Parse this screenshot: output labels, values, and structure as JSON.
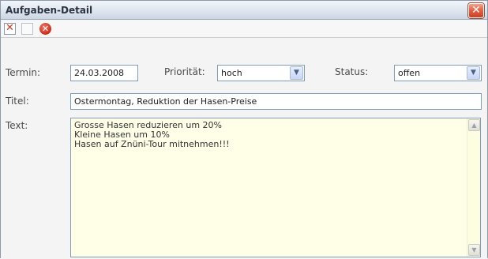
{
  "window": {
    "title": "Aufgaben-Detail",
    "close_symbol": "✕"
  },
  "toolbar": {
    "check_symbol": "✕",
    "delete_symbol": "✕"
  },
  "form": {
    "termin_label": "Termin:",
    "termin_value": "24.03.2008",
    "prioritaet_label": "Priorität:",
    "prioritaet_value": "hoch",
    "status_label": "Status:",
    "status_value": "offen",
    "titel_label": "Titel:",
    "titel_value": "Ostermontag, Reduktion der Hasen-Preise",
    "text_label": "Text:",
    "text_lines": [
      "Grosse Hasen reduzieren um 20%",
      "Kleine Hasen um 10%",
      "Hasen auf Znüni-Tour mitnehmen!!!"
    ]
  },
  "colors": {
    "textarea_background": "#ffffe8",
    "close_button": "#e05f3f",
    "input_border": "#7f9db9"
  },
  "icons": {
    "close": "close-icon",
    "select_arrow": "chevron-down-icon",
    "scroll_up": "chevron-up-icon",
    "scroll_down": "chevron-down-icon"
  }
}
